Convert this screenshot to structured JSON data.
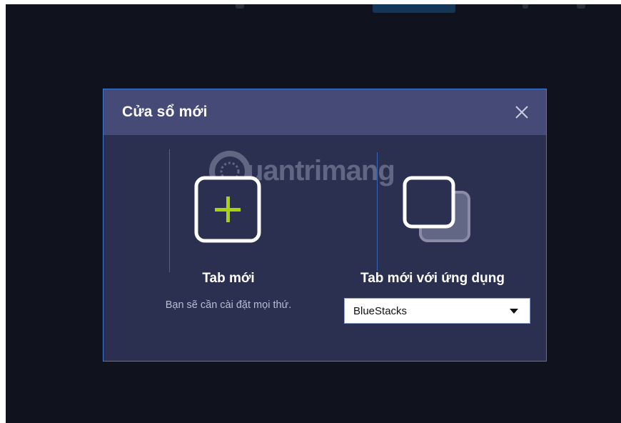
{
  "dialog": {
    "title": "Cửa sổ mới",
    "close_icon": "close-icon"
  },
  "options": {
    "new_tab": {
      "label": "Tab mới",
      "description": "Bạn sẽ cần cài đặt mọi thứ.",
      "icon": "add-tab-icon"
    },
    "new_tab_with_app": {
      "label": "Tab mới với ứng dụng",
      "icon": "duplicate-tab-icon",
      "select": {
        "selected": "BlueStacks"
      }
    }
  },
  "watermark": {
    "text": "uantrimang"
  },
  "colors": {
    "background": "#10131d",
    "dialog_bg": "#2c3050",
    "header_bg": "#454a76",
    "border": "#3d7ad6",
    "plus_accent": "#a6d30b",
    "divider": "#3566b8"
  }
}
